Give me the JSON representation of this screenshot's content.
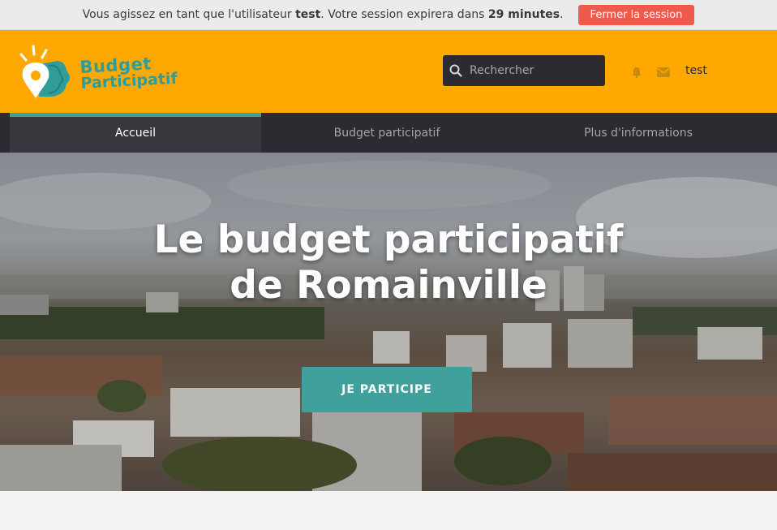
{
  "impersonation": {
    "prefix": "Vous agissez en tant que l'utilisateur ",
    "username": "test",
    "middle": ". Votre session expirera dans ",
    "duration": "29 minutes",
    "suffix": ".",
    "logout_label": "Fermer la session"
  },
  "header": {
    "logo_line1": "Budget",
    "logo_line2": "Participatif",
    "search_placeholder": "Rechercher",
    "user_name": "test"
  },
  "nav": {
    "tabs": [
      {
        "label": "Accueil",
        "active": true
      },
      {
        "label": "Budget participatif",
        "active": false
      },
      {
        "label": "Plus d'informations",
        "active": false
      }
    ]
  },
  "hero": {
    "title_line1": "Le budget participatif",
    "title_line2": "de Romainville",
    "cta_label": "JE PARTICIPE"
  },
  "colors": {
    "brand_orange": "#ffa800",
    "accent_teal": "#40a19c",
    "nav_dark": "#2e2a32",
    "logout_red": "#ef5a4c"
  },
  "icons": {
    "search": "search-icon",
    "bell": "bell-icon",
    "mail": "mail-icon"
  }
}
